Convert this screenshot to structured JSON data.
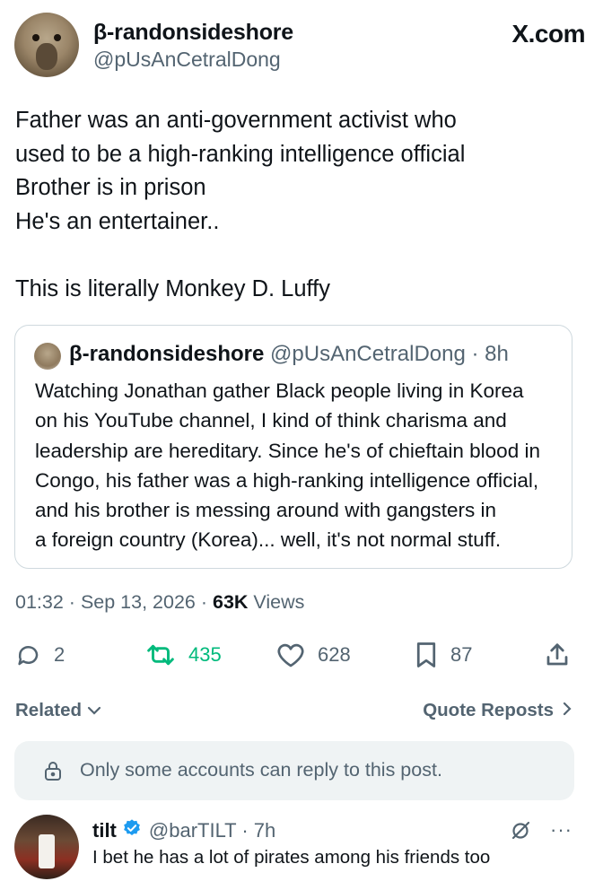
{
  "author": {
    "name": "β-randonsideshore",
    "handle": "@pUsAnCetralDong"
  },
  "site_label": "X.com",
  "tweet": {
    "lines": [
      "Father was an anti-government activist who",
      "used to be a high-ranking intelligence official",
      "Brother is in prison",
      "He's an entertainer..",
      "",
      "This is literally Monkey D. Luffy"
    ]
  },
  "quote": {
    "name": "β-randonsideshore",
    "meta": "@pUsAnCetralDong · 8h",
    "lines": [
      "Watching Jonathan gather Black people living in Korea",
      "on his YouTube channel, I kind of think charisma and",
      "leadership are hereditary. Since he's of chieftain blood in",
      "Congo, his father was a high-ranking intelligence official,",
      "and his brother is messing around with gangsters in",
      "a foreign country (Korea)... well, it's not normal stuff."
    ]
  },
  "meta": {
    "time": "01:32",
    "date": "Sep 13, 2026",
    "views_count": "63K",
    "views_label": "Views"
  },
  "actions": {
    "replies": "2",
    "reposts": "435",
    "likes": "628",
    "bookmarks": "87"
  },
  "colors": {
    "repost_green": "#00ba7c",
    "muted": "#536471",
    "verified_blue": "#1d9bf0"
  },
  "related_label": "Related",
  "quote_reposts_label": "Quote Reposts",
  "reply_notice": "Only some accounts can reply to this post.",
  "reply": {
    "name": "tilt",
    "meta": "@barTILT · 7h",
    "text": "I bet he has a lot of pirates among his friends too",
    "more": "···"
  }
}
